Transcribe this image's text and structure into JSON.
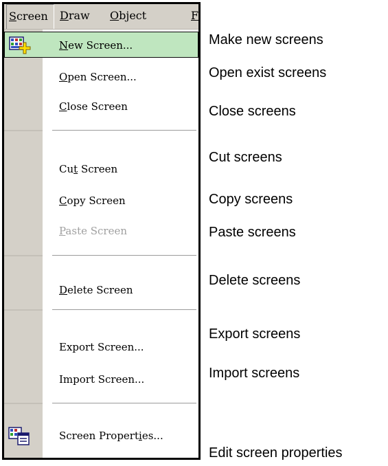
{
  "menubar": {
    "items": [
      {
        "label": "Screen",
        "mnemonic": "S",
        "rest": "creen"
      },
      {
        "label": "Draw",
        "mnemonic": "D",
        "rest": "raw"
      },
      {
        "label": "Object",
        "mnemonic": "O",
        "rest": "bject"
      },
      {
        "label": "F",
        "mnemonic": "F",
        "rest": ""
      }
    ]
  },
  "menu": {
    "items": [
      {
        "label": "New Screen...",
        "pre": "",
        "mnemonic": "N",
        "post": "ew Screen...",
        "icon": "new-screen-icon",
        "state": "highlighted"
      },
      {
        "label": "Open Screen...",
        "pre": "",
        "mnemonic": "O",
        "post": "pen Screen...",
        "state": "normal"
      },
      {
        "label": "Close Screen",
        "pre": "",
        "mnemonic": "C",
        "post": "lose Screen",
        "state": "normal"
      },
      {
        "label": "Cut Screen",
        "pre": "Cu",
        "mnemonic": "t",
        "post": " Screen",
        "state": "normal"
      },
      {
        "label": "Copy Screen",
        "pre": "",
        "mnemonic": "C",
        "post": "opy Screen",
        "state": "normal"
      },
      {
        "label": "Paste Screen",
        "pre": "",
        "mnemonic": "P",
        "post": "aste Screen",
        "state": "disabled"
      },
      {
        "label": "Delete Screen",
        "pre": "",
        "mnemonic": "D",
        "post": "elete Screen",
        "state": "normal"
      },
      {
        "label": "Export Screen...",
        "pre": "Export Screen...",
        "mnemonic": "",
        "post": "",
        "state": "normal"
      },
      {
        "label": "Import Screen...",
        "pre": "Import Screen...",
        "mnemonic": "",
        "post": "",
        "state": "normal"
      },
      {
        "label": "Screen Properties...",
        "pre": "Screen Propert",
        "mnemonic": "i",
        "post": "es...",
        "icon": "screen-properties-icon",
        "state": "normal"
      }
    ]
  },
  "annotations": {
    "new": "Make new screens",
    "open": "Open exist screens",
    "close": "Close screens",
    "cut": "Cut screens",
    "copy": "Copy screens",
    "paste": "Paste screens",
    "delete": "Delete screens",
    "export": "Export screens",
    "import": "Import screens",
    "properties": "Edit screen properties"
  },
  "colors": {
    "menu_gutter": "#d4d0c8",
    "highlight": "#bfe6bf",
    "disabled_text": "#a0a0a0"
  }
}
